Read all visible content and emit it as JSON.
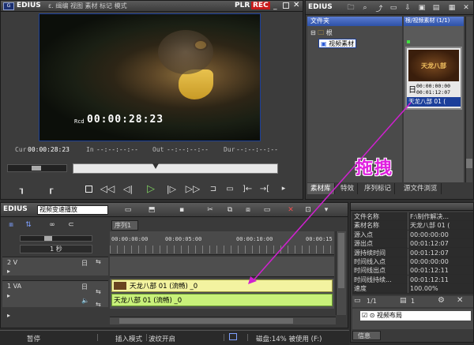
{
  "player": {
    "app_name": "EDIUS",
    "menu_text": "ɛ. 缉编 视图 素材 标记 模式",
    "plr_label": "PLR",
    "rec_label": "REC",
    "rec_timecode_label": "Rcd",
    "rec_timecode": "00:00:28:23",
    "cur_label": "Cur",
    "cur_value": "00:00:28:23",
    "in_label": "In",
    "in_value": "--:--:--:--",
    "out_label": "Out",
    "out_value": "--:--:--:--",
    "dur_label": "Dur",
    "dur_value": "--:--:--:--"
  },
  "bin": {
    "folder_panel_title": "文件夹",
    "tree_root": "根",
    "tree_child": "视频素材",
    "clip_panel_title": "根/视频素材 (1/1)",
    "clip_thumb_text": "天龙八部",
    "clip_tc1": "00:00:00:00",
    "clip_tc2": "00:01:12:07",
    "clip_name": "天龙八部 01 (",
    "tabs": [
      "素材库",
      "特效",
      "序列标记",
      "源文件浏览"
    ]
  },
  "annotation": {
    "drag_text": "拖拽",
    "arrow_color": "#d020d0"
  },
  "timeline": {
    "app_name": "EDIUS",
    "mode_value": "视频变速播放",
    "sequence_tab": "序列1",
    "scale_value": "1 秒",
    "ruler_ticks": [
      "00:00:00:00",
      "00:00:05:00",
      "00:00:10:00",
      "00:00:15"
    ],
    "tracks": [
      {
        "name": "2 V"
      },
      {
        "name": "1 VA"
      }
    ],
    "video_clip_label": "天龙八部 01 (流畅) _0",
    "audio_clip_label": "天龙八部 01 (流畅) _0"
  },
  "info": {
    "rows": [
      {
        "key": "文件名称",
        "val": "F:\\制作解决..."
      },
      {
        "key": "素材名称",
        "val": "天龙八部 01 ("
      },
      {
        "key": "源入点",
        "val": "00:00:00:00"
      },
      {
        "key": "源出点",
        "val": "00:01:12:07"
      },
      {
        "key": "源持续时间",
        "val": "00:01:12:07"
      },
      {
        "key": "时间线入点",
        "val": "00:00:00:00"
      },
      {
        "key": "时间线出点",
        "val": "00:01:12:11"
      },
      {
        "key": "时间线持续...",
        "val": "00:01:12:11"
      },
      {
        "key": "速度",
        "val": "100.00%"
      }
    ],
    "page_label": "1/1",
    "count_label": "1",
    "effect_item": "视频布局",
    "tab_label": "信息"
  },
  "status": {
    "items": [
      "暂停",
      "插入模式",
      "波纹开启",
      "磁盘:14% 被使用 (F:)"
    ]
  },
  "colors": {
    "accent_blue": "#1c3f9a",
    "rec_red": "#c81818",
    "clip_yellow": "#f3f3a0",
    "clip_green": "#c8f07a"
  }
}
